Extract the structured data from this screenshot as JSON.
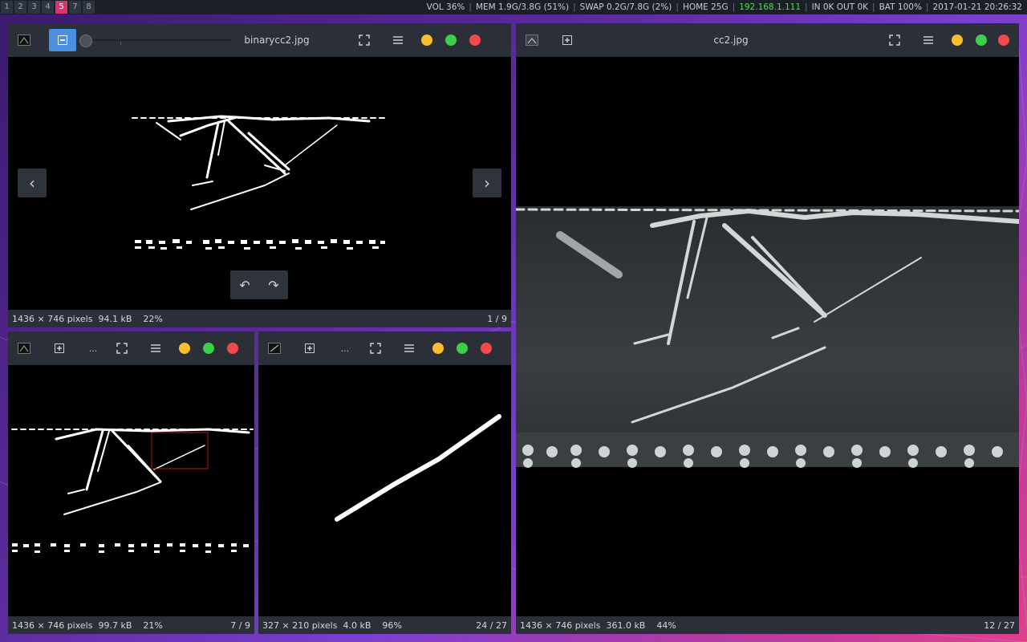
{
  "topbar": {
    "workspaces": [
      "1",
      "2",
      "3",
      "4",
      "5",
      "7",
      "8"
    ],
    "active_workspace": "5",
    "vol": "VOL 36%",
    "mem": "MEM 1.9G/3.8G (51%)",
    "swap": "SWAP 0.2G/7.8G (2%)",
    "home": "HOME 25G",
    "ip": "192.168.1.111",
    "net": "IN 0K OUT 0K",
    "bat": "BAT 100%",
    "datetime": "2017-01-21 20:26:32"
  },
  "win_main": {
    "title": "binarycc2.jpg",
    "info": "1436 × 746 pixels  94.1 kB    22%",
    "index": "1 / 9",
    "prev": "‹",
    "next": "›"
  },
  "win_bl": {
    "more": "...",
    "info": "1436 × 746 pixels  99.7 kB    21%",
    "index": "7 / 9"
  },
  "win_bm": {
    "more": "...",
    "info": "327 × 210 pixels  4.0 kB    96%",
    "index": "24 / 27"
  },
  "win_right": {
    "title": "cc2.jpg",
    "info": "1436 × 746 pixels  361.0 kB    44%",
    "index": "12 / 27"
  },
  "icons": [
    "image-thumbnail-icon",
    "zoom-out-icon",
    "add-icon",
    "fullscreen-icon",
    "menu-icon",
    "rotate-left-icon",
    "rotate-right-icon",
    "chevron-left-icon",
    "chevron-right-icon"
  ]
}
